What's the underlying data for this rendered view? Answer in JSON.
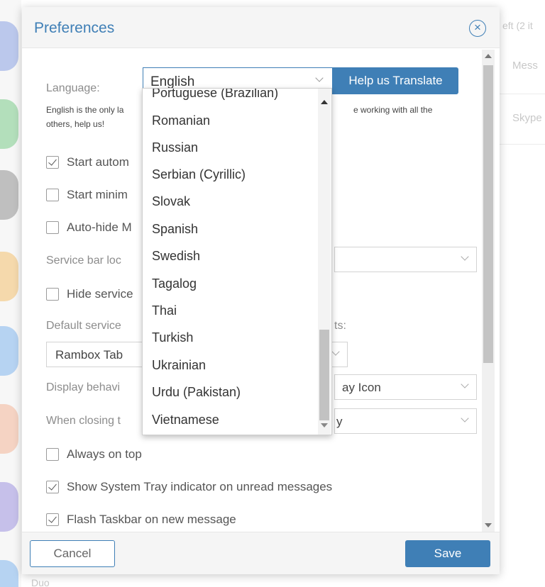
{
  "background": {
    "right_texts": [
      "eft (2 it",
      "Mess",
      "Skype"
    ],
    "bottom_text": "Duo"
  },
  "modal": {
    "title": "Preferences",
    "close_icon": "close-circle-icon",
    "language_label": "Language:",
    "language_value": "English",
    "help_translate_label": "Help us Translate",
    "language_note_line1_start": "English is the only la",
    "language_note_line1_end": "e working with all the",
    "language_note_line2": "others, help us!",
    "start_auto_label": "Start autom",
    "start_minimized_label": "Start minim",
    "auto_hide_label": "Auto-hide M",
    "service_bar_label": "Service bar loc",
    "hide_service_label": "Hide service",
    "default_service_label": "Default service",
    "default_service_suffix": "ts:",
    "rambox_tab_value": "Rambox Tab",
    "display_behavior_label": "Display behavi",
    "display_behavior_value": "ay Icon",
    "when_closing_label": "When closing t",
    "when_closing_value": "y",
    "always_on_top_label": "Always on top",
    "system_tray_label": "Show System Tray indicator on unread messages",
    "flash_taskbar_label": "Flash Taskbar on new message",
    "checkbox_states": {
      "start_auto": true,
      "start_minimized": false,
      "auto_hide": false,
      "hide_service": false,
      "always_on_top": false,
      "system_tray": true,
      "flash_taskbar": true
    },
    "cancel_label": "Cancel",
    "save_label": "Save"
  },
  "dropdown": {
    "partial_item": "Portuguese (Brazilian)",
    "items": [
      "Romanian",
      "Russian",
      "Serbian (Cyrillic)",
      "Slovak",
      "Spanish",
      "Swedish",
      "Tagalog",
      "Thai",
      "Turkish",
      "Ukrainian",
      "Urdu (Pakistan)",
      "Vietnamese"
    ]
  },
  "colors": {
    "accent": "#3f7fb6",
    "header_bg": "#f5f5f5"
  }
}
